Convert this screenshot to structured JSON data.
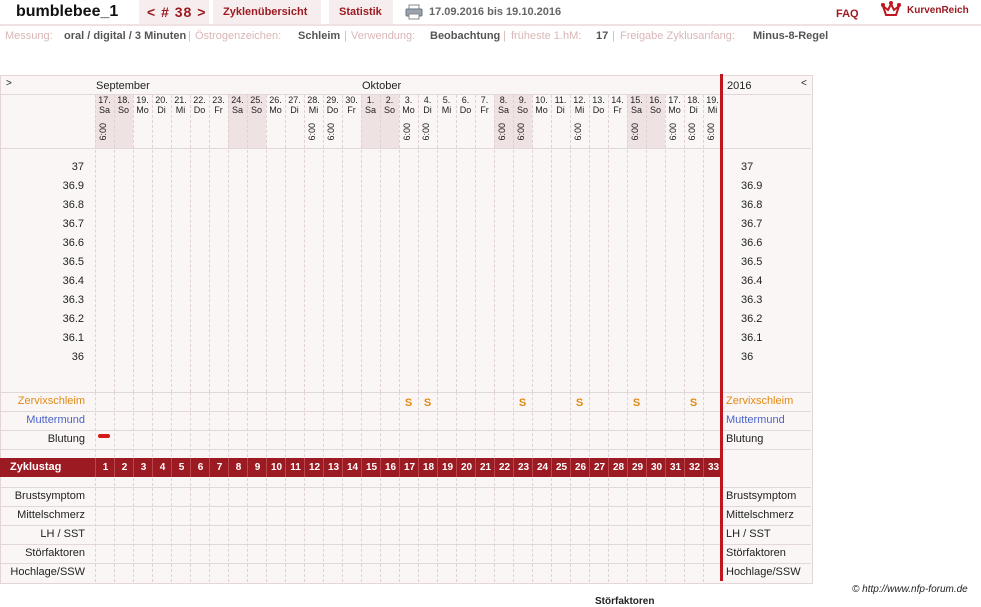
{
  "header": {
    "username": "bumblebee_1",
    "cycle_nav": "< # 38 >",
    "tab_overview": "Zyklenübersicht",
    "tab_stats": "Statistik",
    "date_range": "17.09.2016 bis 19.10.2016",
    "faq": "FAQ",
    "brand": "KurvenReich"
  },
  "info": {
    "messung_label": "Messung:",
    "messung_value": "oral / digital / 3 Minuten",
    "oestrogen_label": "Östrogenzeichen:",
    "oestrogen_value": "Schleim",
    "verwendung_label": "Verwendung:",
    "verwendung_value": "Beobachtung",
    "fruehest_label": "früheste 1.hM:",
    "fruehest_value": "17",
    "freigabe_label": "Freigabe Zyklusanfang:",
    "freigabe_value": "Minus-8-Regel"
  },
  "chart": {
    "left_arrow": ">",
    "right_arrow": "<",
    "month1": "September",
    "month2": "Oktober",
    "year": "2016",
    "days": [
      {
        "d": "17.",
        "wd": "Sa",
        "t": "6:00",
        "we": true
      },
      {
        "d": "18.",
        "wd": "So",
        "t": "",
        "we": true
      },
      {
        "d": "19.",
        "wd": "Mo",
        "t": "",
        "we": false
      },
      {
        "d": "20.",
        "wd": "Di",
        "t": "",
        "we": false
      },
      {
        "d": "21.",
        "wd": "Mi",
        "t": "",
        "we": false
      },
      {
        "d": "22.",
        "wd": "Do",
        "t": "",
        "we": false
      },
      {
        "d": "23.",
        "wd": "Fr",
        "t": "",
        "we": false
      },
      {
        "d": "24.",
        "wd": "Sa",
        "t": "",
        "we": true
      },
      {
        "d": "25.",
        "wd": "So",
        "t": "",
        "we": true
      },
      {
        "d": "26.",
        "wd": "Mo",
        "t": "",
        "we": false
      },
      {
        "d": "27.",
        "wd": "Di",
        "t": "",
        "we": false
      },
      {
        "d": "28.",
        "wd": "Mi",
        "t": "6:00",
        "we": false
      },
      {
        "d": "29.",
        "wd": "Do",
        "t": "6:00",
        "we": false
      },
      {
        "d": "30.",
        "wd": "Fr",
        "t": "",
        "we": false
      },
      {
        "d": "1.",
        "wd": "Sa",
        "t": "",
        "we": true
      },
      {
        "d": "2.",
        "wd": "So",
        "t": "",
        "we": true
      },
      {
        "d": "3.",
        "wd": "Mo",
        "t": "6:00",
        "we": false
      },
      {
        "d": "4.",
        "wd": "Di",
        "t": "6:00",
        "we": false
      },
      {
        "d": "5.",
        "wd": "Mi",
        "t": "",
        "we": false
      },
      {
        "d": "6.",
        "wd": "Do",
        "t": "",
        "we": false
      },
      {
        "d": "7.",
        "wd": "Fr",
        "t": "",
        "we": false
      },
      {
        "d": "8.",
        "wd": "Sa",
        "t": "6:00",
        "we": true
      },
      {
        "d": "9.",
        "wd": "So",
        "t": "6:00",
        "we": true
      },
      {
        "d": "10.",
        "wd": "Mo",
        "t": "",
        "we": false
      },
      {
        "d": "11.",
        "wd": "Di",
        "t": "",
        "we": false
      },
      {
        "d": "12.",
        "wd": "Mi",
        "t": "6:00",
        "we": false
      },
      {
        "d": "13.",
        "wd": "Do",
        "t": "",
        "we": false
      },
      {
        "d": "14.",
        "wd": "Fr",
        "t": "",
        "we": false
      },
      {
        "d": "15.",
        "wd": "Sa",
        "t": "6:00",
        "we": true
      },
      {
        "d": "16.",
        "wd": "So",
        "t": "",
        "we": true
      },
      {
        "d": "17.",
        "wd": "Mo",
        "t": "6:00",
        "we": false
      },
      {
        "d": "18.",
        "wd": "Di",
        "t": "6:00",
        "we": false
      },
      {
        "d": "19.",
        "wd": "Mi",
        "t": "6:00",
        "we": false
      }
    ],
    "temps": [
      "37",
      "36.9",
      "36.8",
      "36.7",
      "36.6",
      "36.5",
      "36.4",
      "36.3",
      "36.2",
      "36.1",
      "36"
    ],
    "rows_top": {
      "zervix": "Zervixschleim",
      "muttermund": "Muttermund",
      "blutung": "Blutung"
    },
    "zervix_marks": [
      {
        "day": 17,
        "sym": "S"
      },
      {
        "day": 18,
        "sym": "S"
      },
      {
        "day": 23,
        "sym": "S"
      },
      {
        "day": 26,
        "sym": "S"
      },
      {
        "day": 29,
        "sym": "S"
      },
      {
        "day": 32,
        "sym": "S"
      }
    ],
    "bleeding_days": [
      1
    ],
    "cycle_label": "Zyklustag",
    "cycle_days": [
      "1",
      "2",
      "3",
      "4",
      "5",
      "6",
      "7",
      "8",
      "9",
      "10",
      "11",
      "12",
      "13",
      "14",
      "15",
      "16",
      "17",
      "18",
      "19",
      "20",
      "21",
      "22",
      "23",
      "24",
      "25",
      "26",
      "27",
      "28",
      "29",
      "30",
      "31",
      "32",
      "33"
    ],
    "rows_bottom": [
      "Brustsymptom",
      "Mittelschmerz",
      "LH / SST",
      "Störfaktoren",
      "Hochlage/SSW"
    ]
  },
  "footer": {
    "copyright": "© http://www.nfp-forum.de",
    "cut_label": "Störfaktoren"
  },
  "colors": {
    "accent": "#9c1b22",
    "zervix": "#e08a13",
    "muttermund": "#4a63c8",
    "redline": "#c0161d"
  }
}
